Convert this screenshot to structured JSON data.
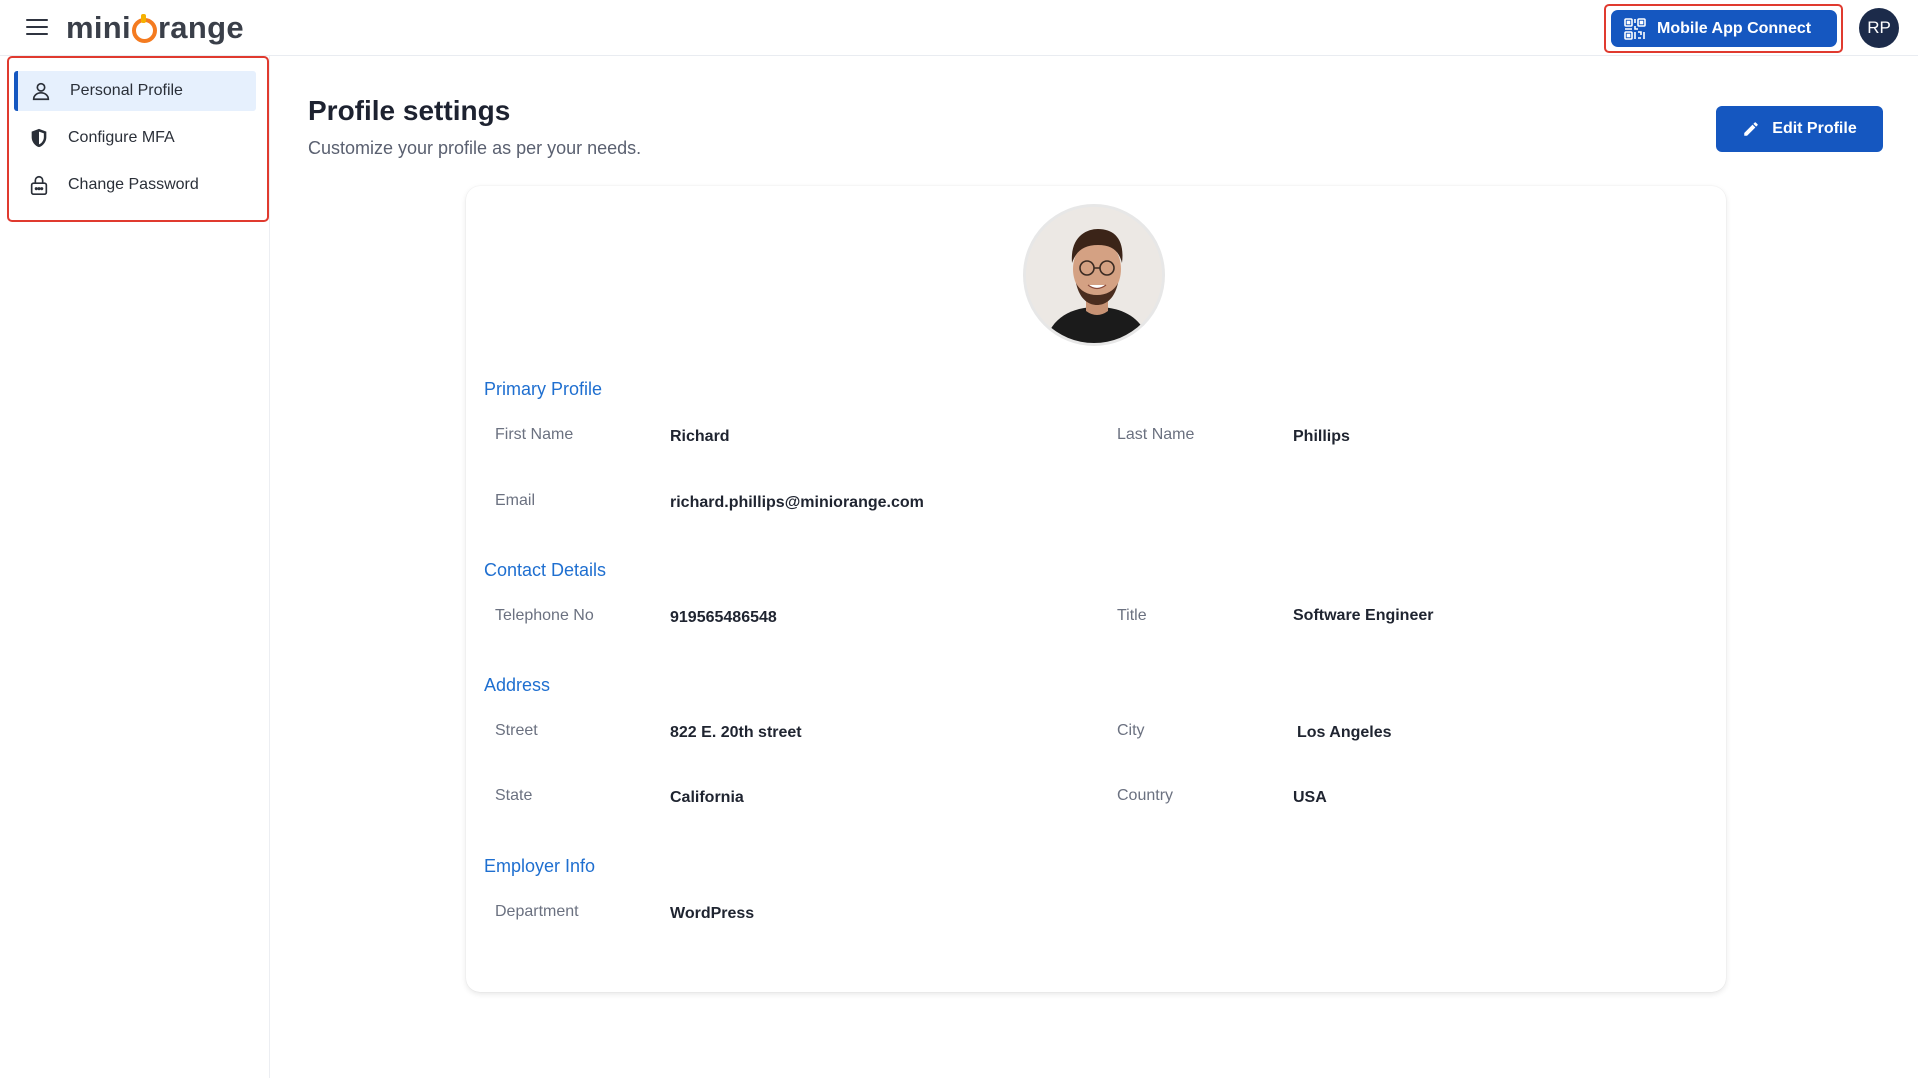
{
  "header": {
    "logo_left": "mini",
    "logo_right": "range",
    "mobile_app_connect": "Mobile App Connect",
    "user_initials": "RP"
  },
  "sidebar": {
    "items": [
      {
        "label": "Personal Profile",
        "icon": "user-icon",
        "active": true
      },
      {
        "label": "Configure MFA",
        "icon": "shield-icon",
        "active": false
      },
      {
        "label": "Change Password",
        "icon": "lock-icon",
        "active": false
      }
    ]
  },
  "page": {
    "title": "Profile settings",
    "subtitle": "Customize your profile as per your needs.",
    "edit_button": "Edit Profile"
  },
  "profile": {
    "primary": {
      "title": "Primary Profile",
      "first_name_label": "First Name",
      "first_name": "Richard",
      "last_name_label": "Last Name",
      "last_name": "Phillips",
      "email_label": "Email",
      "email": "richard.phillips@miniorange.com"
    },
    "contact": {
      "title": "Contact Details",
      "telephone_label": "Telephone No",
      "telephone": "919565486548",
      "title_label": "Title",
      "job_title": "Software Engineer"
    },
    "address": {
      "title": "Address",
      "street_label": "Street",
      "street": "822 E. 20th street",
      "city_label": "City",
      "city": "Los Angeles",
      "state_label": "State",
      "state": "California",
      "country_label": "Country",
      "country": "USA"
    },
    "employer": {
      "title": "Employer Info",
      "department_label": "Department",
      "department": "WordPress"
    }
  },
  "colors": {
    "primary_blue": "#1557c0",
    "section_blue": "#1f6fd0",
    "highlight_red": "#e03a2f",
    "logo_orange": "#f47b20"
  }
}
